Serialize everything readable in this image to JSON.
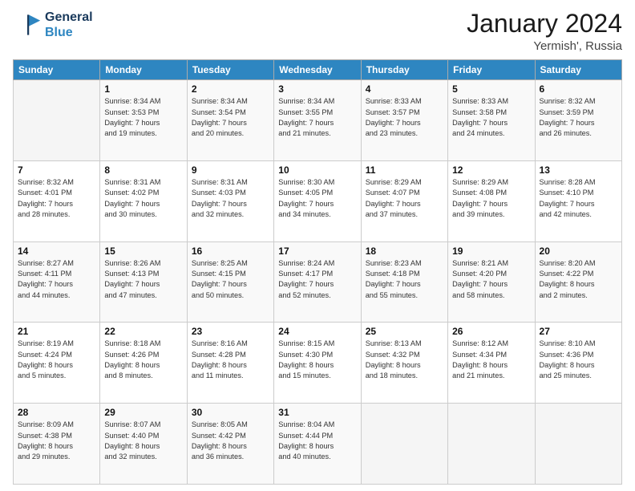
{
  "logo": {
    "line1": "General",
    "line2": "Blue"
  },
  "title": "January 2024",
  "subtitle": "Yermish', Russia",
  "headers": [
    "Sunday",
    "Monday",
    "Tuesday",
    "Wednesday",
    "Thursday",
    "Friday",
    "Saturday"
  ],
  "weeks": [
    [
      {
        "day": "",
        "info": ""
      },
      {
        "day": "1",
        "info": "Sunrise: 8:34 AM\nSunset: 3:53 PM\nDaylight: 7 hours\nand 19 minutes."
      },
      {
        "day": "2",
        "info": "Sunrise: 8:34 AM\nSunset: 3:54 PM\nDaylight: 7 hours\nand 20 minutes."
      },
      {
        "day": "3",
        "info": "Sunrise: 8:34 AM\nSunset: 3:55 PM\nDaylight: 7 hours\nand 21 minutes."
      },
      {
        "day": "4",
        "info": "Sunrise: 8:33 AM\nSunset: 3:57 PM\nDaylight: 7 hours\nand 23 minutes."
      },
      {
        "day": "5",
        "info": "Sunrise: 8:33 AM\nSunset: 3:58 PM\nDaylight: 7 hours\nand 24 minutes."
      },
      {
        "day": "6",
        "info": "Sunrise: 8:32 AM\nSunset: 3:59 PM\nDaylight: 7 hours\nand 26 minutes."
      }
    ],
    [
      {
        "day": "7",
        "info": "Sunrise: 8:32 AM\nSunset: 4:01 PM\nDaylight: 7 hours\nand 28 minutes."
      },
      {
        "day": "8",
        "info": "Sunrise: 8:31 AM\nSunset: 4:02 PM\nDaylight: 7 hours\nand 30 minutes."
      },
      {
        "day": "9",
        "info": "Sunrise: 8:31 AM\nSunset: 4:03 PM\nDaylight: 7 hours\nand 32 minutes."
      },
      {
        "day": "10",
        "info": "Sunrise: 8:30 AM\nSunset: 4:05 PM\nDaylight: 7 hours\nand 34 minutes."
      },
      {
        "day": "11",
        "info": "Sunrise: 8:29 AM\nSunset: 4:07 PM\nDaylight: 7 hours\nand 37 minutes."
      },
      {
        "day": "12",
        "info": "Sunrise: 8:29 AM\nSunset: 4:08 PM\nDaylight: 7 hours\nand 39 minutes."
      },
      {
        "day": "13",
        "info": "Sunrise: 8:28 AM\nSunset: 4:10 PM\nDaylight: 7 hours\nand 42 minutes."
      }
    ],
    [
      {
        "day": "14",
        "info": "Sunrise: 8:27 AM\nSunset: 4:11 PM\nDaylight: 7 hours\nand 44 minutes."
      },
      {
        "day": "15",
        "info": "Sunrise: 8:26 AM\nSunset: 4:13 PM\nDaylight: 7 hours\nand 47 minutes."
      },
      {
        "day": "16",
        "info": "Sunrise: 8:25 AM\nSunset: 4:15 PM\nDaylight: 7 hours\nand 50 minutes."
      },
      {
        "day": "17",
        "info": "Sunrise: 8:24 AM\nSunset: 4:17 PM\nDaylight: 7 hours\nand 52 minutes."
      },
      {
        "day": "18",
        "info": "Sunrise: 8:23 AM\nSunset: 4:18 PM\nDaylight: 7 hours\nand 55 minutes."
      },
      {
        "day": "19",
        "info": "Sunrise: 8:21 AM\nSunset: 4:20 PM\nDaylight: 7 hours\nand 58 minutes."
      },
      {
        "day": "20",
        "info": "Sunrise: 8:20 AM\nSunset: 4:22 PM\nDaylight: 8 hours\nand 2 minutes."
      }
    ],
    [
      {
        "day": "21",
        "info": "Sunrise: 8:19 AM\nSunset: 4:24 PM\nDaylight: 8 hours\nand 5 minutes."
      },
      {
        "day": "22",
        "info": "Sunrise: 8:18 AM\nSunset: 4:26 PM\nDaylight: 8 hours\nand 8 minutes."
      },
      {
        "day": "23",
        "info": "Sunrise: 8:16 AM\nSunset: 4:28 PM\nDaylight: 8 hours\nand 11 minutes."
      },
      {
        "day": "24",
        "info": "Sunrise: 8:15 AM\nSunset: 4:30 PM\nDaylight: 8 hours\nand 15 minutes."
      },
      {
        "day": "25",
        "info": "Sunrise: 8:13 AM\nSunset: 4:32 PM\nDaylight: 8 hours\nand 18 minutes."
      },
      {
        "day": "26",
        "info": "Sunrise: 8:12 AM\nSunset: 4:34 PM\nDaylight: 8 hours\nand 21 minutes."
      },
      {
        "day": "27",
        "info": "Sunrise: 8:10 AM\nSunset: 4:36 PM\nDaylight: 8 hours\nand 25 minutes."
      }
    ],
    [
      {
        "day": "28",
        "info": "Sunrise: 8:09 AM\nSunset: 4:38 PM\nDaylight: 8 hours\nand 29 minutes."
      },
      {
        "day": "29",
        "info": "Sunrise: 8:07 AM\nSunset: 4:40 PM\nDaylight: 8 hours\nand 32 minutes."
      },
      {
        "day": "30",
        "info": "Sunrise: 8:05 AM\nSunset: 4:42 PM\nDaylight: 8 hours\nand 36 minutes."
      },
      {
        "day": "31",
        "info": "Sunrise: 8:04 AM\nSunset: 4:44 PM\nDaylight: 8 hours\nand 40 minutes."
      },
      {
        "day": "",
        "info": ""
      },
      {
        "day": "",
        "info": ""
      },
      {
        "day": "",
        "info": ""
      }
    ]
  ]
}
